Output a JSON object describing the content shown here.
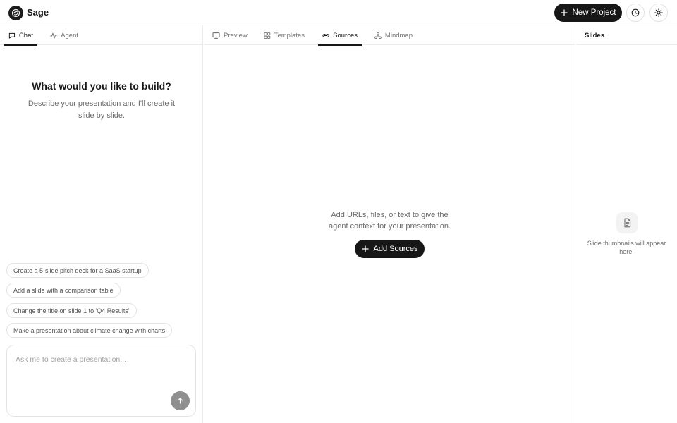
{
  "app": {
    "name": "Sage"
  },
  "header": {
    "new_project_label": "New Project",
    "history_icon": "clock-icon",
    "theme_icon": "sun-icon"
  },
  "left": {
    "tabs": [
      {
        "label": "Chat",
        "icon": "message-square-icon",
        "active": true
      },
      {
        "label": "Agent",
        "icon": "activity-icon",
        "active": false
      }
    ],
    "hero": {
      "title": "What would you like to build?",
      "subtitle": "Describe your presentation and I'll create it slide by slide."
    },
    "suggestions": [
      "Create a 5-slide pitch deck for a SaaS startup",
      "Add a slide with a comparison table",
      "Change the title on slide 1 to 'Q4 Results'",
      "Make a presentation about climate change with charts"
    ],
    "chat": {
      "placeholder": "Ask me to create a presentation...",
      "value": ""
    }
  },
  "center": {
    "tabs": [
      {
        "label": "Preview",
        "icon": "monitor-icon",
        "active": false
      },
      {
        "label": "Templates",
        "icon": "grid-icon",
        "active": false
      },
      {
        "label": "Sources",
        "icon": "link-icon",
        "active": true
      },
      {
        "label": "Mindmap",
        "icon": "mindmap-icon",
        "active": false
      }
    ],
    "empty_text": "Add URLs, files, or text to give the agent context for your presentation.",
    "add_sources_label": "Add Sources"
  },
  "right": {
    "title": "Slides",
    "empty_hint": "Slide thumbnails will appear here."
  },
  "colors": {
    "primary": "#171717",
    "border": "#ececec",
    "muted_text": "#6b6b6b",
    "send_button": "#8f8f8f"
  }
}
